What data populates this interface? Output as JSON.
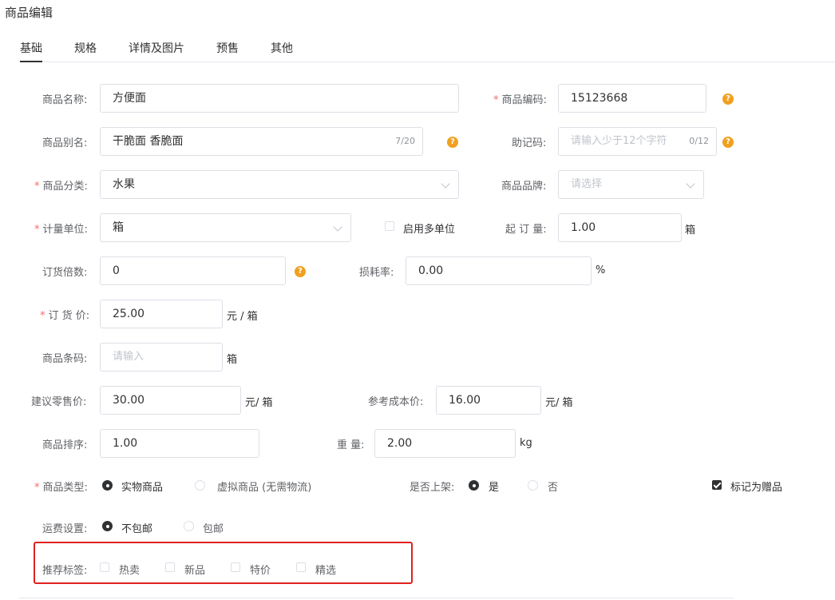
{
  "page": {
    "title": "商品编辑"
  },
  "tabs": [
    {
      "label": "基础",
      "active": true
    },
    {
      "label": "规格",
      "active": false
    },
    {
      "label": "详情及图片",
      "active": false
    },
    {
      "label": "预售",
      "active": false
    },
    {
      "label": "其他",
      "active": false
    }
  ],
  "form": {
    "name": {
      "label": "商品名称:",
      "value": "方便面"
    },
    "code": {
      "label": "商品编码:",
      "value": "15123668"
    },
    "alias": {
      "label": "商品别名:",
      "value": "干脆面 香脆面",
      "counter": "7/20"
    },
    "mnemonic": {
      "label": "助记码:",
      "placeholder": "请输入少于12个字符",
      "counter": "0/12"
    },
    "category": {
      "label": "商品分类:",
      "value": "水果"
    },
    "brand": {
      "label": "商品品牌:",
      "placeholder": "请选择"
    },
    "unit": {
      "label": "计量单位:",
      "value": "箱"
    },
    "multi_unit": {
      "label": "启用多单位",
      "checked": false
    },
    "min_order": {
      "label": "起 订 量:",
      "value": "1.00",
      "unit": "箱"
    },
    "order_multiple": {
      "label": "订货倍数:",
      "value": "0"
    },
    "loss_rate": {
      "label": "损耗率:",
      "value": "0.00",
      "unit": "%"
    },
    "order_price": {
      "label": "订 货 价:",
      "value": "25.00",
      "unit": "元 / 箱"
    },
    "barcode": {
      "label": "商品条码:",
      "placeholder": "请输入",
      "unit": "箱"
    },
    "retail_price": {
      "label": "建议零售价:",
      "value": "30.00",
      "unit": "元/ 箱"
    },
    "ref_cost": {
      "label": "参考成本价:",
      "value": "16.00",
      "unit": "元/ 箱"
    },
    "sort": {
      "label": "商品排序:",
      "value": "1.00"
    },
    "weight": {
      "label": "重 量:",
      "value": "2.00",
      "unit": "kg"
    },
    "type": {
      "label": "商品类型:",
      "options": [
        {
          "label": "实物商品",
          "checked": true
        },
        {
          "label": "虚拟商品 (无需物流)",
          "checked": false
        }
      ]
    },
    "on_shelf": {
      "label": "是否上架:",
      "options": [
        {
          "label": "是",
          "checked": true
        },
        {
          "label": "否",
          "checked": false
        }
      ]
    },
    "gift": {
      "label": "标记为赠品",
      "checked": true
    },
    "shipping": {
      "label": "运费设置:",
      "options": [
        {
          "label": "不包邮",
          "checked": true
        },
        {
          "label": "包邮",
          "checked": false
        }
      ]
    },
    "tags": {
      "label": "推荐标签:",
      "options": [
        {
          "label": "热卖",
          "checked": false
        },
        {
          "label": "新品",
          "checked": false
        },
        {
          "label": "特价",
          "checked": false
        },
        {
          "label": "精选",
          "checked": false
        }
      ]
    }
  },
  "icons": {
    "help": "?"
  },
  "colors": {
    "required": "#f56c6c",
    "help": "#f0a020",
    "highlight": "#e02020"
  }
}
